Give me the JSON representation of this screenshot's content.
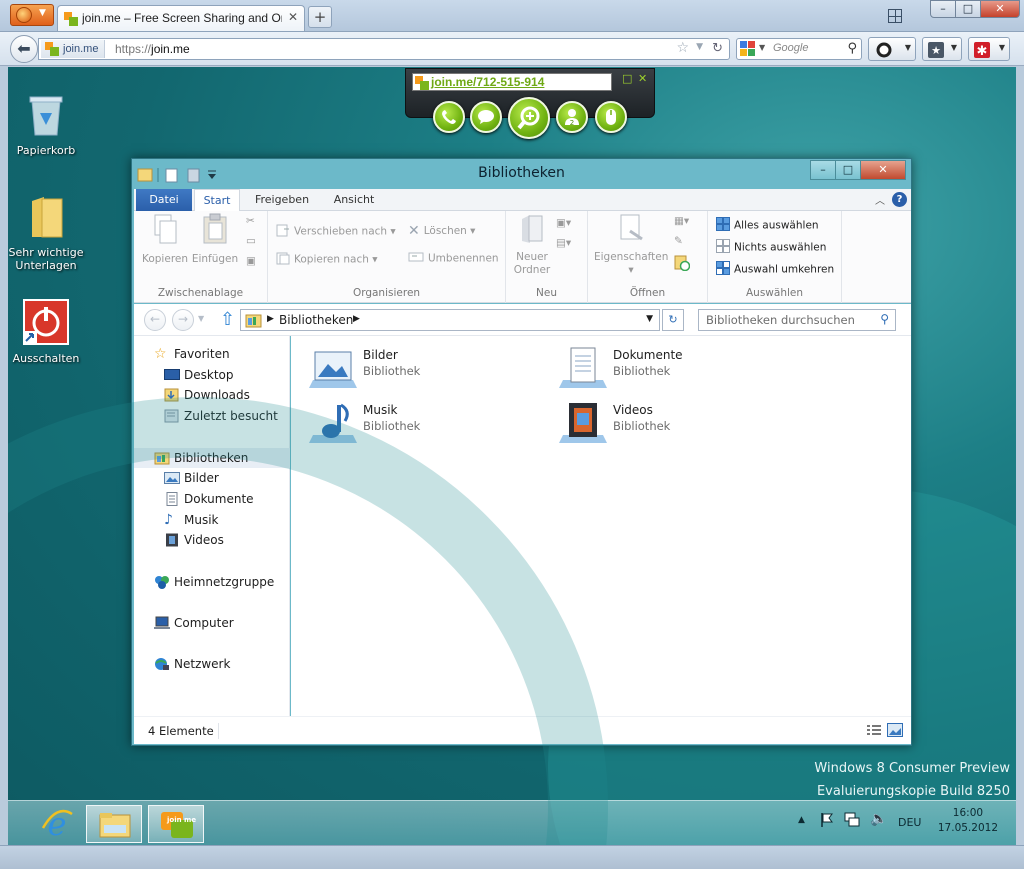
{
  "browser": {
    "tab_title": "join.me – Free Screen Sharing and Onlin…",
    "url_site": "join.me",
    "url_prefix": "https://",
    "url_host": "join.me",
    "search_placeholder": "Google"
  },
  "joinme": {
    "link": "join.me/712-515-914",
    "accent": "#7ab51d"
  },
  "desktop": {
    "icons": [
      {
        "label": "Papierkorb"
      },
      {
        "label": "Sehr wichtige Unterlagen"
      },
      {
        "label": "Ausschalten"
      }
    ],
    "watermark_line1": "Windows 8 Consumer Preview",
    "watermark_line2": "Evaluierungskopie Build 8250"
  },
  "explorer": {
    "title": "Bibliotheken",
    "tabs": {
      "datei": "Datei",
      "start": "Start",
      "freigeben": "Freigeben",
      "ansicht": "Ansicht"
    },
    "ribbon": {
      "kopieren": "Kopieren",
      "einfuegen": "Einfügen",
      "group_zwischenablage": "Zwischenablage",
      "verschieben_nach": "Verschieben nach",
      "kopieren_nach": "Kopieren nach",
      "loeschen": "Löschen",
      "umbenennen": "Umbenennen",
      "group_organisieren": "Organisieren",
      "neuer_ordner_1": "Neuer",
      "neuer_ordner_2": "Ordner",
      "group_neu": "Neu",
      "eigenschaften": "Eigenschaften",
      "group_oeffnen": "Öffnen",
      "alles_auswaehlen": "Alles auswählen",
      "nichts_auswaehlen": "Nichts auswählen",
      "auswahl_umkehren": "Auswahl umkehren",
      "group_auswaehlen": "Auswählen"
    },
    "address": "Bibliotheken",
    "search_placeholder": "Bibliotheken durchsuchen",
    "nav": {
      "favoriten": "Favoriten",
      "desktop": "Desktop",
      "downloads": "Downloads",
      "zuletzt": "Zuletzt besucht",
      "bibliotheken": "Bibliotheken",
      "bilder": "Bilder",
      "dokumente": "Dokumente",
      "musik": "Musik",
      "videos": "Videos",
      "heimnetzgruppe": "Heimnetzgruppe",
      "computer": "Computer",
      "netzwerk": "Netzwerk"
    },
    "libraries": [
      {
        "name": "Bilder",
        "type": "Bibliothek"
      },
      {
        "name": "Dokumente",
        "type": "Bibliothek"
      },
      {
        "name": "Musik",
        "type": "Bibliothek"
      },
      {
        "name": "Videos",
        "type": "Bibliothek"
      }
    ],
    "status": "4 Elemente"
  },
  "taskbar": {
    "language": "DEU",
    "time": "16:00",
    "date": "17.05.2012",
    "joinme_label": "join me"
  }
}
